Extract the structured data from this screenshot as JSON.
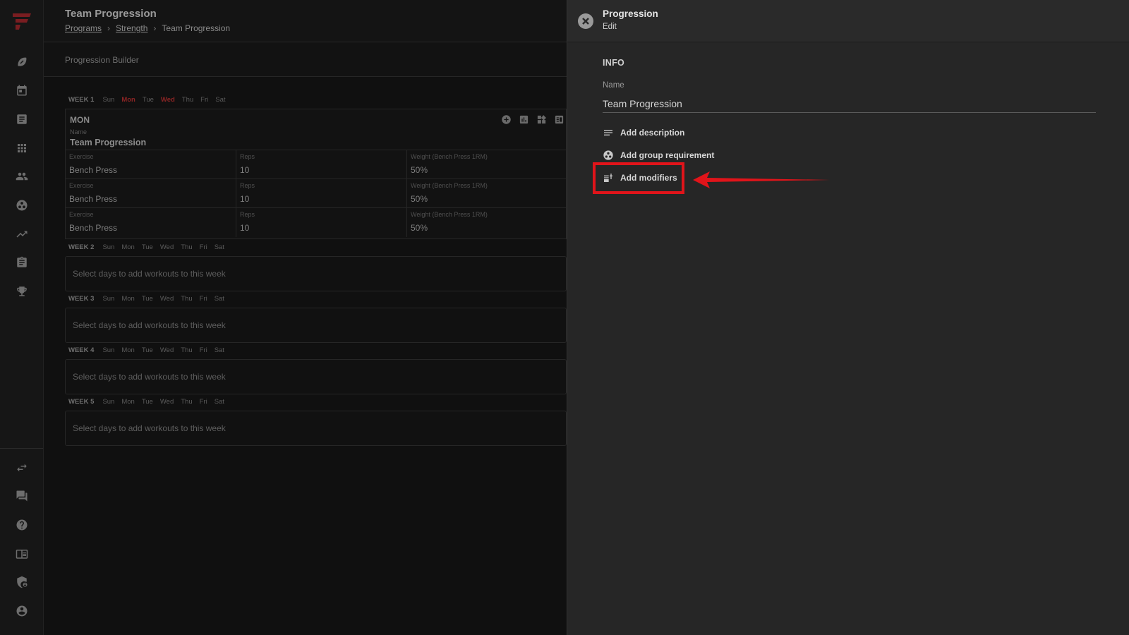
{
  "header": {
    "title": "Team Progression",
    "breadcrumb": [
      "Programs",
      "Strength",
      "Team Progression"
    ]
  },
  "subheader": {
    "title": "Progression Builder"
  },
  "days_of_week": [
    "Sun",
    "Mon",
    "Tue",
    "Wed",
    "Thu",
    "Fri",
    "Sat"
  ],
  "weeks": [
    {
      "label": "WEEK 1",
      "active_days": [
        "Mon",
        "Wed"
      ]
    },
    {
      "label": "WEEK 2",
      "empty_text": "Select days to add workouts to this week"
    },
    {
      "label": "WEEK 3",
      "empty_text": "Select days to add workouts to this week"
    },
    {
      "label": "WEEK 4",
      "empty_text": "Select days to add workouts to this week"
    },
    {
      "label": "WEEK 5",
      "empty_text": "Select days to add workouts to this week"
    }
  ],
  "day_card": {
    "title": "MON",
    "name_label": "Name",
    "name_value": "Team Progression",
    "tool_icons": [
      "add-circle-icon",
      "chart-icon",
      "widgets-icon",
      "list-icon"
    ],
    "columns": [
      "Exercise",
      "Reps",
      "Weight (Bench Press 1RM)"
    ],
    "rows": [
      [
        "Bench Press",
        "10",
        "50%"
      ],
      [
        "Bench Press",
        "10",
        "50%"
      ],
      [
        "Bench Press",
        "10",
        "50%"
      ]
    ]
  },
  "panel": {
    "title": "Progression",
    "subtitle": "Edit",
    "section": "INFO",
    "name_label": "Name",
    "name_value": "Team Progression",
    "actions": [
      {
        "label": "Add description",
        "icon": "notes-icon"
      },
      {
        "label": "Add group requirement",
        "icon": "group-icon"
      },
      {
        "label": "Add modifiers",
        "icon": "modifiers-icon"
      }
    ]
  },
  "annotation": {
    "color": "#e0141a",
    "target": "Add modifiers"
  },
  "colors": {
    "accent": "#b3262b",
    "active_day": "#8b2424"
  },
  "rail_icons": [
    "football-icon",
    "calendar-icon",
    "notes-icon",
    "grid-icon",
    "people-icon",
    "group-icon",
    "trending-icon",
    "clipboard-icon",
    "trophy-icon",
    "swap-icon",
    "chat-icon",
    "help-icon",
    "library-icon",
    "shield-icon",
    "account-icon"
  ]
}
